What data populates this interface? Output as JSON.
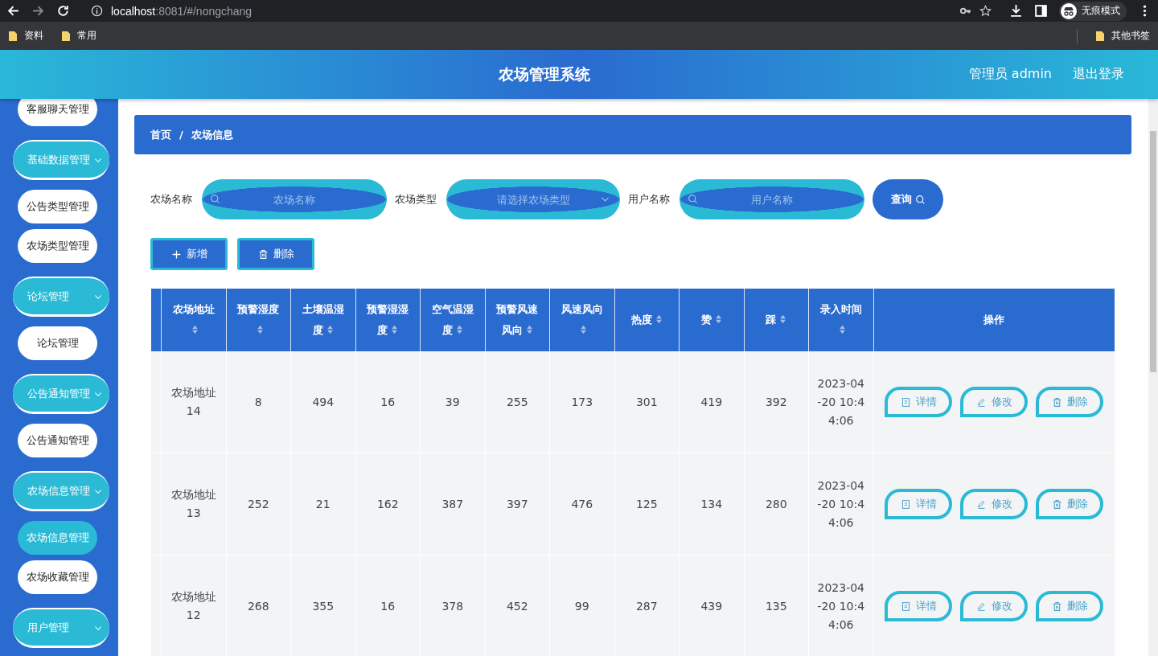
{
  "browser": {
    "url_host": "localhost",
    "url_rest": ":8081/#/nongchang",
    "bookmarks": [
      "资料",
      "常用"
    ],
    "other_bookmarks": "其他书签",
    "profile": "无痕模式"
  },
  "header": {
    "title": "农场管理系统",
    "user": "管理员 admin",
    "logout": "退出登录"
  },
  "sidebar": {
    "items": [
      {
        "kind": "item",
        "label": "客服聊天管理",
        "selected": false
      },
      {
        "kind": "group",
        "label": "基础数据管理",
        "expanded": true
      },
      {
        "kind": "item",
        "label": "公告类型管理",
        "selected": false
      },
      {
        "kind": "item",
        "label": "农场类型管理",
        "selected": false
      },
      {
        "kind": "group",
        "label": "论坛管理",
        "expanded": true
      },
      {
        "kind": "item",
        "label": "论坛管理",
        "selected": false
      },
      {
        "kind": "group",
        "label": "公告通知管理",
        "expanded": true
      },
      {
        "kind": "item",
        "label": "公告通知管理",
        "selected": false
      },
      {
        "kind": "group",
        "label": "农场信息管理",
        "expanded": true
      },
      {
        "kind": "item",
        "label": "农场信息管理",
        "selected": true
      },
      {
        "kind": "item",
        "label": "农场收藏管理",
        "selected": false
      },
      {
        "kind": "group",
        "label": "用户管理",
        "expanded": true
      }
    ]
  },
  "breadcrumb": {
    "separator": "/",
    "items": [
      "首页",
      "农场信息"
    ]
  },
  "filters": [
    {
      "kind": "search",
      "label": "农场名称",
      "placeholder": "农场名称"
    },
    {
      "kind": "select",
      "label": "农场类型",
      "placeholder": "请选择农场类型"
    },
    {
      "kind": "search",
      "label": "用户名称",
      "placeholder": "用户名称"
    }
  ],
  "query_button": "查询",
  "actions": [
    {
      "kind": "add",
      "label": "新增"
    },
    {
      "kind": "delete",
      "label": "删除"
    }
  ],
  "table": {
    "columns": [
      {
        "label": "农场地址",
        "sortable": true
      },
      {
        "label": "预警湿度",
        "sortable": true
      },
      {
        "label": "土壤温湿度",
        "sortable": true
      },
      {
        "label": "预警湿湿度",
        "sortable": true
      },
      {
        "label": "空气温湿度",
        "sortable": true
      },
      {
        "label": "预警风速风向",
        "sortable": true
      },
      {
        "label": "风速风向",
        "sortable": true
      },
      {
        "label": "热度",
        "sortable": true
      },
      {
        "label": "赞",
        "sortable": true
      },
      {
        "label": "踩",
        "sortable": true
      },
      {
        "label": "录入时间",
        "sortable": true
      },
      {
        "label": "操作",
        "sortable": false
      }
    ],
    "rows": [
      {
        "cells": [
          "农场地址14",
          "8",
          "494",
          "16",
          "39",
          "255",
          "173",
          "301",
          "419",
          "392",
          "2023-04-20 10:44:06"
        ],
        "actions": [
          {
            "kind": "detail",
            "label": "详情"
          },
          {
            "kind": "edit",
            "label": "修改"
          },
          {
            "kind": "delete",
            "label": "删除"
          }
        ]
      },
      {
        "cells": [
          "农场地址13",
          "252",
          "21",
          "162",
          "387",
          "397",
          "476",
          "125",
          "134",
          "280",
          "2023-04-20 10:44:06"
        ],
        "actions": [
          {
            "kind": "detail",
            "label": "详情"
          },
          {
            "kind": "edit",
            "label": "修改"
          },
          {
            "kind": "delete",
            "label": "删除"
          }
        ]
      },
      {
        "cells": [
          "农场地址12",
          "268",
          "355",
          "16",
          "378",
          "452",
          "99",
          "287",
          "439",
          "135",
          "2023-04-20 10:44:06"
        ],
        "actions": [
          {
            "kind": "detail",
            "label": "详情"
          },
          {
            "kind": "edit",
            "label": "修改"
          },
          {
            "kind": "delete",
            "label": "删除"
          }
        ]
      }
    ]
  }
}
